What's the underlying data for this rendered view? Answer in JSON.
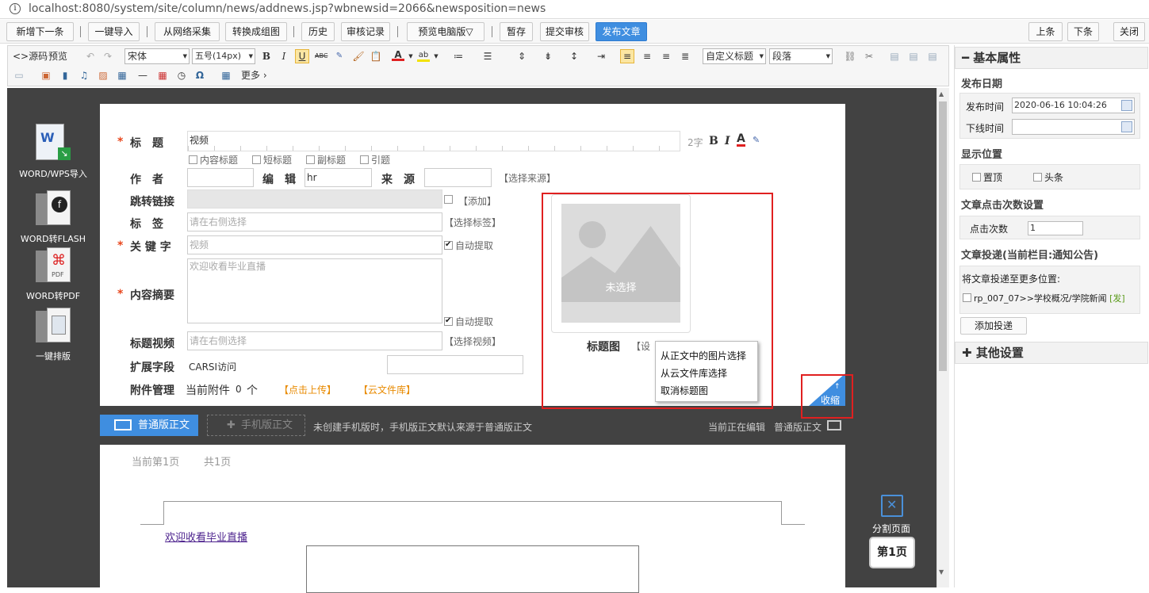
{
  "browser": {
    "url": "localhost:8080/system/site/column/news/addnews.jsp?wbnewsid=2066&newsposition=news"
  },
  "toolbar": {
    "buttons": [
      "新增下一条",
      "一键导入",
      "从网络采集",
      "转换成组图",
      "历史",
      "审核记录",
      "预览电脑版▽",
      "暂存",
      "提交审核",
      "发布文章"
    ],
    "right_buttons": [
      "上条",
      "下条",
      "关闭"
    ]
  },
  "editor": {
    "source": "<>源码",
    "preview": "预览",
    "font_family": "宋体",
    "font_size": "五号(14px)",
    "heading": "自定义标题",
    "paragraph": "段落",
    "more": "更多 ›",
    "bold": "B",
    "italic": "I",
    "underline": "U",
    "strike": "ABC",
    "font_color": "A",
    "omega": "Ω"
  },
  "sidetools": [
    {
      "label": "WORD/WPS导入",
      "icon": "word-icon"
    },
    {
      "label": "WORD转FLASH",
      "icon": "flash-icon"
    },
    {
      "label": "WORD转PDF",
      "icon": "pdf-icon"
    },
    {
      "label": "一键排版",
      "icon": "layout-icon"
    }
  ],
  "form": {
    "title_label": "标　题",
    "title_value": "视频",
    "title_count": "2字",
    "title_options": [
      "内容标题",
      "短标题",
      "副标题",
      "引题"
    ],
    "author_label": "作　者",
    "editor_label": "编　辑",
    "editor_value": "hr",
    "source_label": "来　源",
    "source_link": "【选择来源】",
    "jump_label": "跳转链接",
    "jump_add": "【添加】",
    "tag_label": "标　签",
    "tag_placeholder": "请在右侧选择",
    "tag_link": "【选择标签】",
    "keyword_label": "关 键 字",
    "keyword_placeholder": "视频",
    "auto_extract": "自动提取",
    "summary_label": "内容摘要",
    "summary_placeholder": "欢迎收看毕业直播",
    "video_label": "标题视频",
    "video_placeholder": "请在右侧选择",
    "video_link": "【选择视频】",
    "ext_label": "扩展字段",
    "ext_name": "CARSI访问",
    "attach_label": "附件管理",
    "attach_text": "当前附件",
    "attach_count": "0",
    "attach_unit": "个",
    "upload_link": "【点击上传】",
    "cloud_link": "【云文件库】",
    "title_image_placeholder": "未选择",
    "title_image_label": "标题图",
    "title_image_set": "【设",
    "collapse": "收缩"
  },
  "context_menu": [
    "从正文中的图片选择",
    "从云文件库选择",
    "取消标题图"
  ],
  "body_bar": {
    "normal_tab": "普通版正文",
    "mobile_tab": "手机版正文",
    "hint": "未创建手机版时，手机版正文默认来源于普通版正文",
    "editing": "当前正在编辑",
    "editing_mode": "普通版正文"
  },
  "page": {
    "current": "当前第1页",
    "total": "共1页",
    "link_text": "欢迎收看毕业直播",
    "split": "分割页面",
    "page_badge": "第1页"
  },
  "right_panel": {
    "basic": "基本属性",
    "publish_date": "发布日期",
    "publish_time_label": "发布时间",
    "publish_time_value": "2020-06-16 10:04:26",
    "offline_label": "下线时间",
    "display_pos": "显示位置",
    "top_option": "置顶",
    "headline_option": "头条",
    "click_setting": "文章点击次数设置",
    "click_label": "点击次数",
    "click_value": "1",
    "deliver": "文章投递(当前栏目:通知公告)",
    "deliver_more": "将文章投递至更多位置:",
    "deliver_item": "rp_007_07>>学校概况/学院新闻",
    "deliver_tag": "[发]",
    "add_deliver": "添加投递",
    "other": "其他设置"
  },
  "colors": {
    "accent": "#3f8ee0",
    "highlight": "#e02020",
    "workspace": "#424242"
  }
}
